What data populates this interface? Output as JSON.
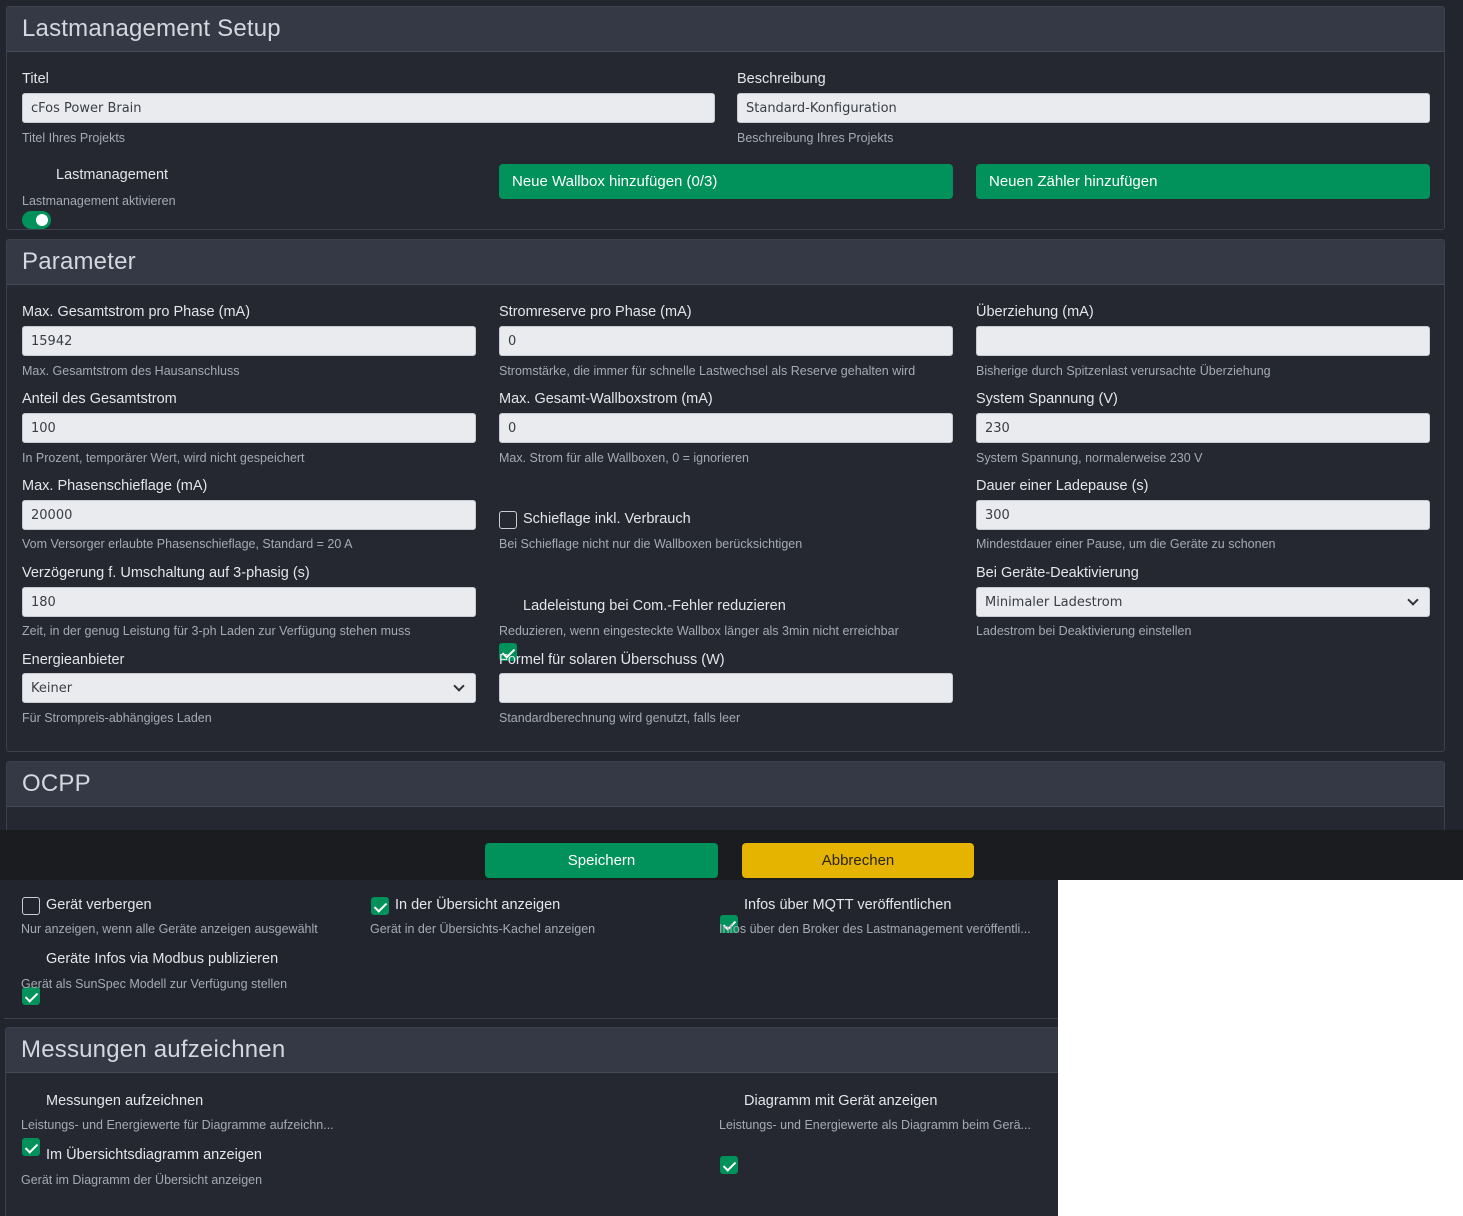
{
  "setup": {
    "title": "Lastmanagement Setup",
    "titel_label": "Titel",
    "titel_value": "cFos Power Brain",
    "titel_hint": "Titel Ihres Projekts",
    "beschreibung_label": "Beschreibung",
    "beschreibung_value": "Standard-Konfiguration",
    "beschreibung_hint": "Beschreibung Ihres Projekts",
    "lastmanagement_label": "Lastmanagement",
    "lastmanagement_hint": "Lastmanagement aktivieren",
    "lastmanagement_on": true,
    "add_wallbox_label": "Neue Wallbox hinzufügen (0/3)",
    "add_meter_label": "Neuen Zähler hinzufügen"
  },
  "parameter": {
    "title": "Parameter",
    "max_gesamtstrom": {
      "label": "Max. Gesamtstrom pro Phase (mA)",
      "value": "15942",
      "hint": "Max. Gesamtstrom des Hausanschluss"
    },
    "stromreserve": {
      "label": "Stromreserve pro Phase (mA)",
      "value": "0",
      "hint": "Stromstärke, die immer für schnelle Lastwechsel als Reserve gehalten wird"
    },
    "ueberziehung": {
      "label": "Überziehung (mA)",
      "value": "",
      "hint": "Bisherige durch Spitzenlast verursachte Überziehung"
    },
    "anteil": {
      "label": "Anteil des Gesamtstrom",
      "value": "100",
      "hint": "In Prozent, temporärer Wert, wird nicht gespeichert"
    },
    "max_wallboxstrom": {
      "label": "Max. Gesamt-Wallboxstrom (mA)",
      "value": "0",
      "hint": "Max. Strom für alle Wallboxen, 0 = ignorieren"
    },
    "spannung": {
      "label": "System Spannung (V)",
      "value": "230",
      "hint": "System Spannung, normalerweise 230 V"
    },
    "schieflage": {
      "label": "Max. Phasenschieflage (mA)",
      "value": "20000",
      "hint": "Vom Versorger erlaubte Phasenschieflage, Standard = 20 A"
    },
    "schieflage_verbrauch": {
      "label": "Schieflage inkl. Verbrauch",
      "hint": "Bei Schieflage nicht nur die Wallboxen berücksichtigen",
      "checked": false
    },
    "ladepause": {
      "label": "Dauer einer Ladepause (s)",
      "value": "300",
      "hint": "Mindestdauer einer Pause, um die Geräte zu schonen"
    },
    "verzoegerung": {
      "label": "Verzögerung f. Umschaltung auf 3-phasig (s)",
      "value": "180",
      "hint": "Zeit, in der genug Leistung für 3-ph Laden zur Verfügung stehen muss"
    },
    "com_fehler": {
      "label": "Ladeleistung bei Com.-Fehler reduzieren",
      "hint": "Reduzieren, wenn eingesteckte Wallbox länger als 3min nicht erreichbar",
      "checked": true
    },
    "deaktivierung": {
      "label": "Bei Geräte-Deaktivierung",
      "value": "Minimaler Ladestrom",
      "hint": "Ladestrom bei Deaktivierung einstellen"
    },
    "energieanbieter": {
      "label": "Energieanbieter",
      "value": "Keiner",
      "hint": "Für Strompreis-abhängiges Laden"
    },
    "formel": {
      "label": "Formel für solaren Überschuss (W)",
      "value": "",
      "hint": "Standardberechnung wird genutzt, falls leer"
    }
  },
  "ocpp": {
    "title": "OCPP"
  },
  "actions": {
    "save_label": "Speichern",
    "cancel_label": "Abbrechen"
  },
  "device": {
    "verbergen": {
      "label": "Gerät verbergen",
      "hint": "Nur anzeigen, wenn alle Geräte anzeigen ausgewählt",
      "checked": false
    },
    "uebersicht": {
      "label": "In der Übersicht anzeigen",
      "hint": "Gerät in der Übersichts-Kachel anzeigen",
      "checked": true
    },
    "mqtt": {
      "label": "Infos über MQTT veröffentlichen",
      "hint": "Infos über den Broker des Lastmanagement veröffentli...",
      "checked": true
    },
    "modbus": {
      "label": "Geräte Infos via Modbus publizieren",
      "hint": "Gerät als SunSpec Modell zur Verfügung stellen",
      "checked": true
    }
  },
  "messungen": {
    "title": "Messungen aufzeichnen",
    "aufzeichnen": {
      "label": "Messungen aufzeichnen",
      "hint": "Leistungs- und Energiewerte für Diagramme aufzeichn...",
      "checked": true
    },
    "diagramm": {
      "label": "Diagramm mit Gerät anzeigen",
      "hint": "Leistungs- und Energiewerte als Diagramm beim Gerä...",
      "checked": true
    },
    "uebersichtsdiagramm": {
      "label": "Im Übersichtsdiagramm anzeigen",
      "hint": "Gerät im Diagramm der Übersicht anzeigen",
      "checked": true
    }
  },
  "colors": {
    "accent_green": "#00925a",
    "accent_yellow": "#e5b400",
    "background": "#23252e",
    "header": "#353945"
  }
}
